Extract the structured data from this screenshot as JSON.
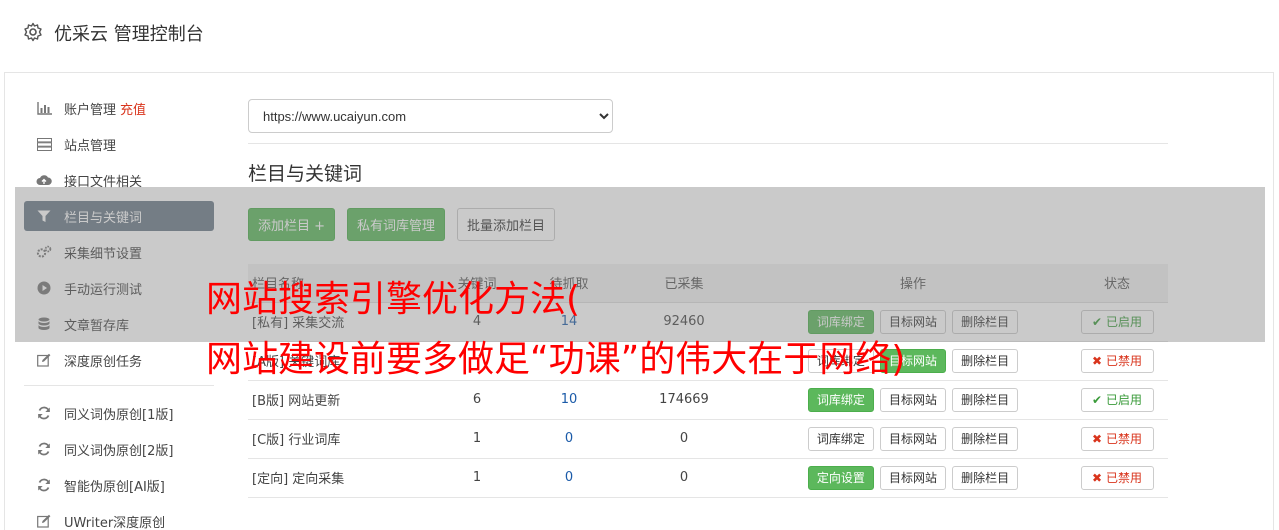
{
  "header": {
    "title": "优采云 管理控制台"
  },
  "sidebar": {
    "items": [
      {
        "label": "账户管理",
        "extra": "充值",
        "icon": "bar-chart-icon"
      },
      {
        "label": "站点管理",
        "icon": "server-icon"
      },
      {
        "label": "接口文件相关",
        "icon": "cloud-upload-icon"
      },
      {
        "label": "栏目与关键词",
        "icon": "filter-icon"
      },
      {
        "label": "采集细节设置",
        "icon": "cogs-icon"
      },
      {
        "label": "手动运行测试",
        "icon": "play-circle-icon"
      },
      {
        "label": "文章暂存库",
        "icon": "database-icon"
      },
      {
        "label": "深度原创任务",
        "icon": "edit-icon"
      },
      {
        "label": "同义词伪原创[1版]",
        "icon": "refresh-icon"
      },
      {
        "label": "同义词伪原创[2版]",
        "icon": "refresh-icon"
      },
      {
        "label": "智能伪原创[AI版]",
        "icon": "refresh-icon"
      },
      {
        "label": "UWriter深度原创",
        "icon": "edit-icon"
      }
    ]
  },
  "main": {
    "site_select": "https://www.ucaiyun.com",
    "section_title": "栏目与关键词",
    "buttons": {
      "add": "添加栏目 +",
      "private_lib": "私有词库管理",
      "batch_add": "批量添加栏目"
    },
    "table": {
      "headers": [
        "栏目名称",
        "关键词",
        "待抓取",
        "已采集",
        "操作",
        "状态"
      ],
      "rows": [
        {
          "tag": "[私有]",
          "name": "采集交流",
          "kw": "4",
          "pending": "14",
          "collected": "92460",
          "op1": "词库绑定",
          "op2": "目标网站",
          "op3": "删除栏目",
          "status": "已启用"
        },
        {
          "tag": "[A版]",
          "name": "关键词库",
          "kw": "",
          "pending": "",
          "collected": "",
          "op1": "词库绑定",
          "op2": "目标网站",
          "op3": "删除栏目",
          "status": "已禁用"
        },
        {
          "tag": "[B版]",
          "name": "网站更新",
          "kw": "6",
          "pending": "10",
          "collected": "174669",
          "op1": "词库绑定",
          "op2": "目标网站",
          "op3": "删除栏目",
          "status": "已启用"
        },
        {
          "tag": "[C版]",
          "name": "行业词库",
          "kw": "1",
          "pending": "0",
          "collected": "0",
          "op1": "词库绑定",
          "op2": "目标网站",
          "op3": "删除栏目",
          "status": "已禁用"
        },
        {
          "tag": "[定向]",
          "name": "定向采集",
          "kw": "1",
          "pending": "0",
          "collected": "0",
          "op1": "定向设置",
          "op2": "目标网站",
          "op3": "删除栏目",
          "status": "已禁用"
        }
      ]
    }
  },
  "watermark": {
    "line1": "网站搜索引擎优化方法(",
    "line2": "网站建设前要多做足“功课”的伟大在于网络)"
  }
}
